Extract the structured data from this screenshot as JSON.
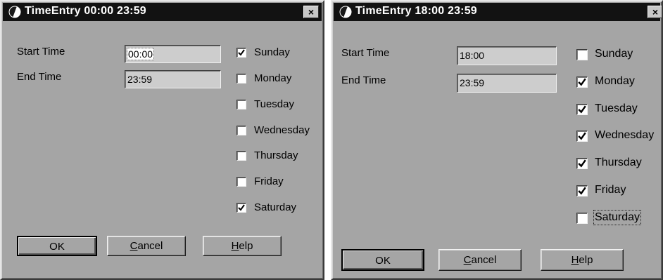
{
  "dialogs": [
    {
      "title": "TimeEntry 00:00 23:59",
      "close_glyph": "×",
      "start_label": "Start Time",
      "start_value": "00:00",
      "end_label": "End Time",
      "end_value": "23:59",
      "days": [
        {
          "label": "Sunday",
          "checked": true
        },
        {
          "label": "Monday",
          "checked": false
        },
        {
          "label": "Tuesday",
          "checked": false
        },
        {
          "label": "Wednesday",
          "checked": false
        },
        {
          "label": "Thursday",
          "checked": false
        },
        {
          "label": "Friday",
          "checked": false
        },
        {
          "label": "Saturday",
          "checked": true
        }
      ],
      "ok_label": "OK",
      "cancel_label": "Cancel",
      "help_label": "Help"
    },
    {
      "title": "TimeEntry 18:00 23:59",
      "close_glyph": "×",
      "start_label": "Start Time",
      "start_value": "18:00",
      "end_label": "End Time",
      "end_value": "23:59",
      "days": [
        {
          "label": "Sunday",
          "checked": false
        },
        {
          "label": "Monday",
          "checked": true
        },
        {
          "label": "Tuesday",
          "checked": true
        },
        {
          "label": "Wednesday",
          "checked": true
        },
        {
          "label": "Thursday",
          "checked": true
        },
        {
          "label": "Friday",
          "checked": true
        },
        {
          "label": "Saturday",
          "checked": false
        }
      ],
      "ok_label": "OK",
      "cancel_label": "Cancel",
      "help_label": "Help"
    }
  ],
  "colors": {
    "dialog_face": "#a5a5a5",
    "title_bar": "#121212",
    "field_bg": "#cdcdcd"
  },
  "icons": {
    "title_icon": "clock-icon",
    "close_icon": "close-icon",
    "check_icon": "checkmark-icon"
  }
}
